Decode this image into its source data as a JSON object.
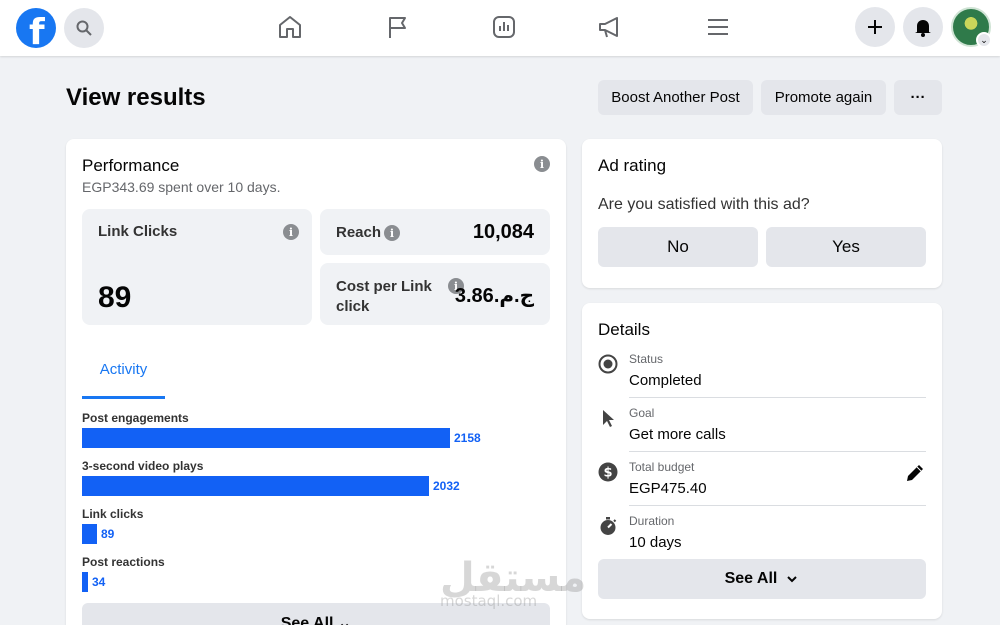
{
  "header": {
    "title": "View results",
    "boost_label": "Boost Another Post",
    "promote_label": "Promote again",
    "more_label": "···"
  },
  "performance": {
    "title": "Performance",
    "subtitle": "EGP343.69 spent over 10 days.",
    "link_clicks": {
      "label": "Link Clicks",
      "value": "89"
    },
    "reach": {
      "label": "Reach",
      "value": "10,084"
    },
    "cost_per_click": {
      "label": "Cost per Link click",
      "value": "ج.م.3.86"
    },
    "tab_label": "Activity",
    "see_all_label": "See All ⌄"
  },
  "activity": {
    "items": [
      {
        "label": "Post engagements",
        "value": 2158
      },
      {
        "label": "3-second video plays",
        "value": 2032
      },
      {
        "label": "Link clicks",
        "value": 89
      },
      {
        "label": "Post reactions",
        "value": 34
      }
    ]
  },
  "ad_rating": {
    "title": "Ad rating",
    "question": "Are you satisfied with this ad?",
    "no_label": "No",
    "yes_label": "Yes"
  },
  "details": {
    "title": "Details",
    "rows": [
      {
        "label": "Status",
        "value": "Completed",
        "icon": "status-icon"
      },
      {
        "label": "Goal",
        "value": "Get more calls",
        "icon": "cursor-icon"
      },
      {
        "label": "Total budget",
        "value": "EGP475.40",
        "icon": "dollar-icon"
      },
      {
        "label": "Duration",
        "value": "10 days",
        "icon": "stopwatch-icon"
      }
    ],
    "see_all_label": "See All"
  },
  "watermark": {
    "text": "مستقل",
    "sub": "mostaql.com"
  },
  "colors": {
    "accent": "#1877f2",
    "bar": "#1261f5"
  }
}
